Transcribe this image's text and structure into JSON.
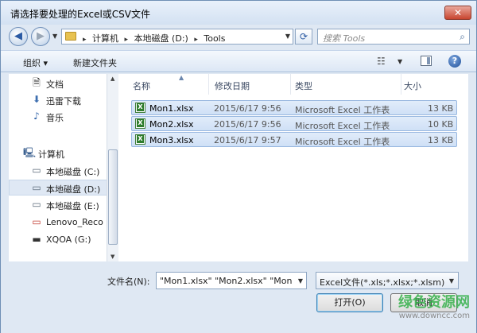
{
  "window": {
    "title": "请选择要处理的Excel或CSV文件",
    "close_glyph": "✕"
  },
  "nav": {
    "back_glyph": "◀",
    "forward_glyph": "▶",
    "crumbs": [
      "计算机",
      "本地磁盘 (D:)",
      "Tools"
    ],
    "crumb_sep": "▸",
    "refresh_glyph": "⟳",
    "search_placeholder": "搜索 Tools",
    "search_icon": "⌕"
  },
  "toolbar": {
    "organize": "组织 ▾",
    "new_folder": "新建文件夹",
    "view_glyph": "☷",
    "help_glyph": "?"
  },
  "sidebar": {
    "items": [
      {
        "label": "文档",
        "icon": "document-icon",
        "glyph": "🗎"
      },
      {
        "label": "迅雷下载",
        "icon": "download-icon",
        "glyph": "⬇"
      },
      {
        "label": "音乐",
        "icon": "music-icon",
        "glyph": "♪"
      },
      {
        "label": "计算机",
        "icon": "computer-icon",
        "glyph": "🖳"
      },
      {
        "label": "本地磁盘 (C:)",
        "icon": "drive-icon",
        "glyph": "▭"
      },
      {
        "label": "本地磁盘 (D:)",
        "icon": "drive-icon",
        "glyph": "▭",
        "selected": true
      },
      {
        "label": "本地磁盘 (E:)",
        "icon": "drive-icon",
        "glyph": "▭"
      },
      {
        "label": "Lenovo_Reco",
        "icon": "drive-icon",
        "glyph": "▭"
      },
      {
        "label": "XQOA (G:)",
        "icon": "drive-icon",
        "glyph": "▬"
      }
    ]
  },
  "files": {
    "columns": [
      "名称",
      "修改日期",
      "类型",
      "大小"
    ],
    "rows": [
      {
        "name": "Mon1.xlsx",
        "date": "2015/6/17 9:56",
        "type": "Microsoft Excel 工作表",
        "size": "13 KB"
      },
      {
        "name": "Mon2.xlsx",
        "date": "2015/6/17 9:56",
        "type": "Microsoft Excel 工作表",
        "size": "10 KB"
      },
      {
        "name": "Mon3.xlsx",
        "date": "2015/6/17 9:57",
        "type": "Microsoft Excel 工作表",
        "size": "13 KB"
      }
    ]
  },
  "bottom": {
    "filename_label": "文件名(N):",
    "filename_value": "\"Mon1.xlsx\" \"Mon2.xlsx\" \"Mon",
    "filter_value": "Excel文件(*.xls;*.xlsx;*.xlsm)",
    "open_label": "打开(O)",
    "cancel_label": "取消"
  },
  "watermark": {
    "main": "绿色资源网",
    "sub": "www.downcc.com"
  }
}
